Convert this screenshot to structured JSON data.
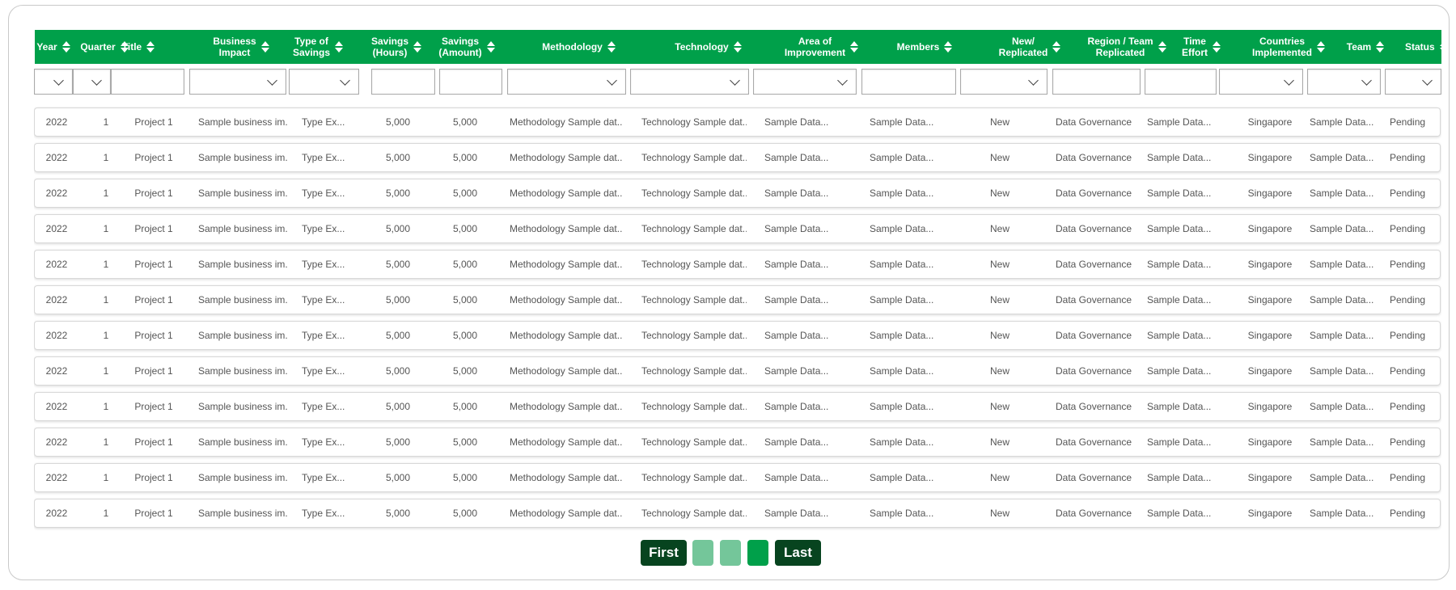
{
  "table": {
    "columns": [
      {
        "key": "year",
        "label": "Year"
      },
      {
        "key": "quarter",
        "label": "Quarter"
      },
      {
        "key": "title",
        "label": "Title"
      },
      {
        "key": "business_impact",
        "label": "Business\nImpact"
      },
      {
        "key": "type_of_savings",
        "label": "Type of\nSavings"
      },
      {
        "key": "savings_hours",
        "label": "Savings\n(Hours)"
      },
      {
        "key": "savings_amount",
        "label": "Savings\n(Amount)"
      },
      {
        "key": "methodology",
        "label": "Methodology"
      },
      {
        "key": "technology",
        "label": "Technology"
      },
      {
        "key": "area_of_improvement",
        "label": "Area of\nImprovement"
      },
      {
        "key": "members",
        "label": "Members"
      },
      {
        "key": "new_replicated",
        "label": "New/\nReplicated"
      },
      {
        "key": "region_team_replicated",
        "label": "Region / Team\nReplicated"
      },
      {
        "key": "time_effort",
        "label": "Time\nEffort"
      },
      {
        "key": "countries_implemented",
        "label": "Countries\nImplemented"
      },
      {
        "key": "team",
        "label": "Team"
      },
      {
        "key": "status",
        "label": "Status"
      }
    ],
    "rows": [
      [
        "2022",
        "1",
        "Project 1",
        "Sample business im...",
        "Type Ex...",
        "5,000",
        "5,000",
        "Methodology Sample dat...",
        "Technology Sample dat...",
        "Sample Data...",
        "Sample Data...",
        "New",
        "Data Governance",
        "Sample Data...",
        "Singapore",
        "Sample Data...",
        "Pending"
      ],
      [
        "2022",
        "1",
        "Project 1",
        "Sample business im...",
        "Type Ex...",
        "5,000",
        "5,000",
        "Methodology Sample dat...",
        "Technology Sample dat...",
        "Sample Data...",
        "Sample Data...",
        "New",
        "Data Governance",
        "Sample Data...",
        "Singapore",
        "Sample Data...",
        "Pending"
      ],
      [
        "2022",
        "1",
        "Project 1",
        "Sample business im...",
        "Type Ex...",
        "5,000",
        "5,000",
        "Methodology Sample dat...",
        "Technology Sample dat...",
        "Sample Data...",
        "Sample Data...",
        "New",
        "Data Governance",
        "Sample Data...",
        "Singapore",
        "Sample Data...",
        "Pending"
      ],
      [
        "2022",
        "1",
        "Project 1",
        "Sample business im...",
        "Type Ex...",
        "5,000",
        "5,000",
        "Methodology Sample dat...",
        "Technology Sample dat...",
        "Sample Data...",
        "Sample Data...",
        "New",
        "Data Governance",
        "Sample Data...",
        "Singapore",
        "Sample Data...",
        "Pending"
      ],
      [
        "2022",
        "1",
        "Project 1",
        "Sample business im...",
        "Type Ex...",
        "5,000",
        "5,000",
        "Methodology Sample dat...",
        "Technology Sample dat...",
        "Sample Data...",
        "Sample Data...",
        "New",
        "Data Governance",
        "Sample Data...",
        "Singapore",
        "Sample Data...",
        "Pending"
      ],
      [
        "2022",
        "1",
        "Project 1",
        "Sample business im...",
        "Type Ex...",
        "5,000",
        "5,000",
        "Methodology Sample dat...",
        "Technology Sample dat...",
        "Sample Data...",
        "Sample Data...",
        "New",
        "Data Governance",
        "Sample Data...",
        "Singapore",
        "Sample Data...",
        "Pending"
      ],
      [
        "2022",
        "1",
        "Project 1",
        "Sample business im...",
        "Type Ex...",
        "5,000",
        "5,000",
        "Methodology Sample dat...",
        "Technology Sample dat...",
        "Sample Data...",
        "Sample Data...",
        "New",
        "Data Governance",
        "Sample Data...",
        "Singapore",
        "Sample Data...",
        "Pending"
      ],
      [
        "2022",
        "1",
        "Project 1",
        "Sample business im...",
        "Type Ex...",
        "5,000",
        "5,000",
        "Methodology Sample dat...",
        "Technology Sample dat...",
        "Sample Data...",
        "Sample Data...",
        "New",
        "Data Governance",
        "Sample Data...",
        "Singapore",
        "Sample Data...",
        "Pending"
      ],
      [
        "2022",
        "1",
        "Project 1",
        "Sample business im...",
        "Type Ex...",
        "5,000",
        "5,000",
        "Methodology Sample dat...",
        "Technology Sample dat...",
        "Sample Data...",
        "Sample Data...",
        "New",
        "Data Governance",
        "Sample Data...",
        "Singapore",
        "Sample Data...",
        "Pending"
      ],
      [
        "2022",
        "1",
        "Project 1",
        "Sample business im...",
        "Type Ex...",
        "5,000",
        "5,000",
        "Methodology Sample dat...",
        "Technology Sample dat...",
        "Sample Data...",
        "Sample Data...",
        "New",
        "Data Governance",
        "Sample Data...",
        "Singapore",
        "Sample Data...",
        "Pending"
      ],
      [
        "2022",
        "1",
        "Project 1",
        "Sample business im...",
        "Type Ex...",
        "5,000",
        "5,000",
        "Methodology Sample dat...",
        "Technology Sample dat...",
        "Sample Data...",
        "Sample Data...",
        "New",
        "Data Governance",
        "Sample Data...",
        "Singapore",
        "Sample Data...",
        "Pending"
      ],
      [
        "2022",
        "1",
        "Project 1",
        "Sample business im...",
        "Type Ex...",
        "5,000",
        "5,000",
        "Methodology Sample dat...",
        "Technology Sample dat...",
        "Sample Data...",
        "Sample Data...",
        "New",
        "Data Governance",
        "Sample Data...",
        "Singapore",
        "Sample Data...",
        "Pending"
      ]
    ]
  },
  "pagination": {
    "first_label": "First",
    "last_label": "Last",
    "pages": [
      {
        "label": "",
        "active": false
      },
      {
        "label": "",
        "active": false
      },
      {
        "label": "",
        "active": true
      }
    ]
  },
  "colors": {
    "header_bg": "#00a04a",
    "nav_button": "#07441f",
    "page_inactive": "#74c69a",
    "page_active": "#00a04a"
  }
}
